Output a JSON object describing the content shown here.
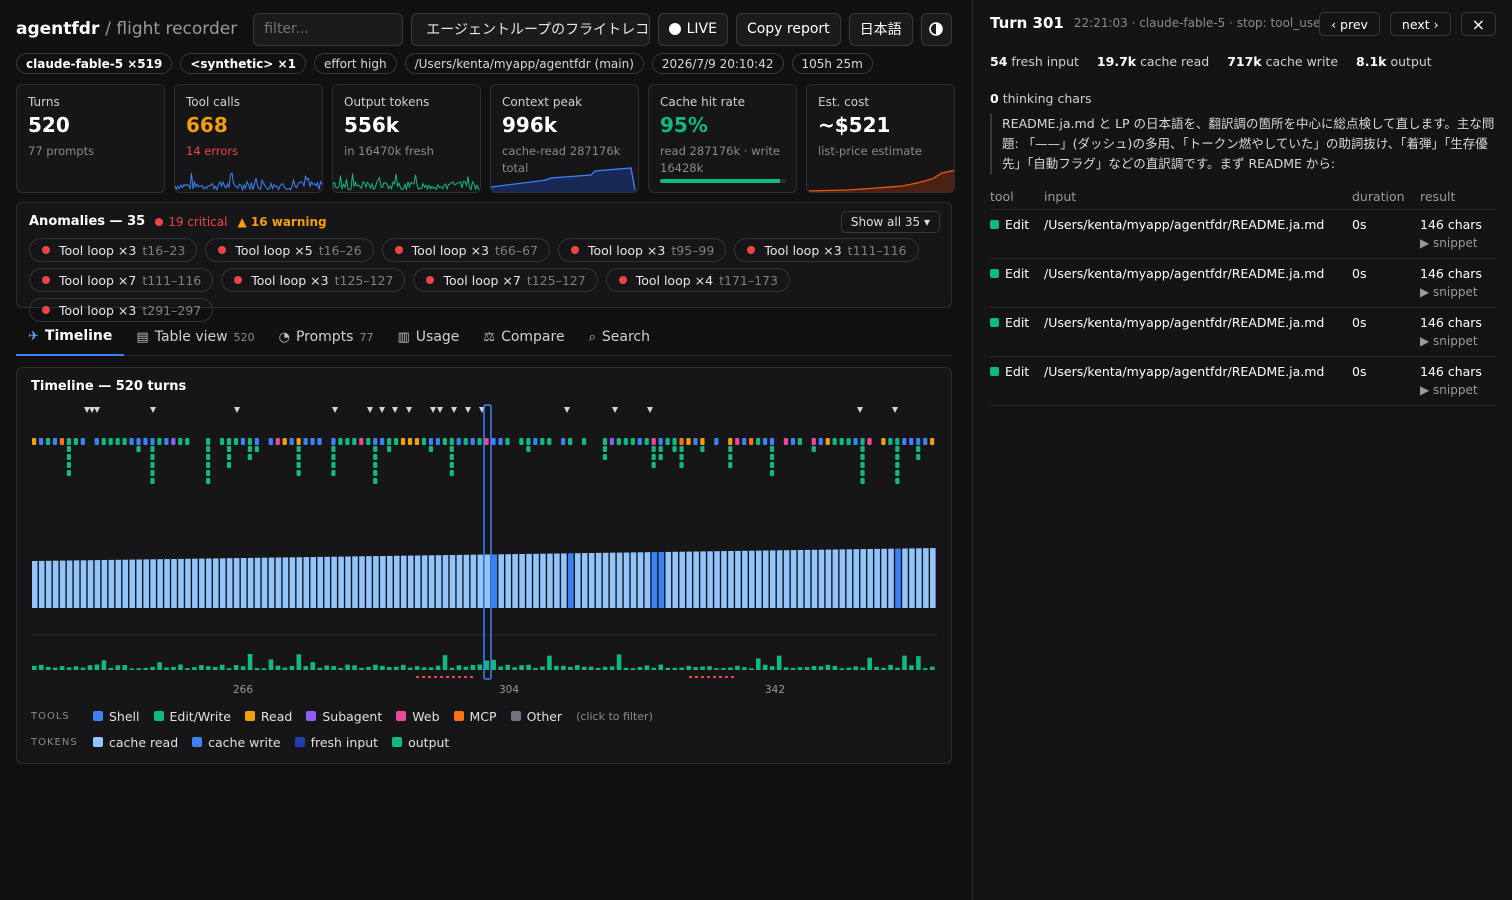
{
  "app": {
    "name": "agentfdr",
    "subtitle": "/ flight recorder"
  },
  "toolbar": {
    "filter_placeholder": "filter...",
    "session_select": "エージェントループのフライトレコーダー",
    "live_label": "LIVE",
    "copy_label": "Copy report",
    "lang_label": "日本語",
    "theme_icon": "half-circle-icon"
  },
  "chips": [
    {
      "strong": "claude-fable-5 ×519",
      "text": ""
    },
    {
      "strong": "<synthetic> ×1",
      "text": ""
    },
    {
      "strong": "",
      "text": "effort high"
    },
    {
      "strong": "",
      "text": "/Users/kenta/myapp/agentfdr (main)"
    },
    {
      "strong": "",
      "text": "2026/7/9 20:10:42"
    },
    {
      "strong": "",
      "text": "105h 25m"
    }
  ],
  "stats": {
    "turns": {
      "label": "Turns",
      "value": "520",
      "sub": "77 prompts"
    },
    "tools": {
      "label": "Tool calls",
      "value": "668",
      "sub": "14 errors"
    },
    "output": {
      "label": "Output tokens",
      "value": "556k",
      "sub": "in 16470k fresh"
    },
    "context": {
      "label": "Context peak",
      "value": "996k",
      "sub": "cache-read 287176k total"
    },
    "cache": {
      "label": "Cache hit rate",
      "value": "95%",
      "sub": "read 287176k · write 16428k",
      "progress": 0.95
    },
    "cost": {
      "label": "Est. cost",
      "value": "~$521",
      "sub": "list-price estimate"
    }
  },
  "anomalies": {
    "title": "Anomalies — 35",
    "critical": "19 critical",
    "warning": "▲ 16 warning",
    "show_all": "Show all 35 ▾",
    "items": [
      {
        "label": "Tool loop ×3",
        "range": "t16–23"
      },
      {
        "label": "Tool loop ×5",
        "range": "t16–26"
      },
      {
        "label": "Tool loop ×3",
        "range": "t66–67"
      },
      {
        "label": "Tool loop ×3",
        "range": "t95–99"
      },
      {
        "label": "Tool loop ×3",
        "range": "t111–116"
      },
      {
        "label": "Tool loop ×7",
        "range": "t111–116"
      },
      {
        "label": "Tool loop ×3",
        "range": "t125–127"
      },
      {
        "label": "Tool loop ×7",
        "range": "t125–127"
      },
      {
        "label": "Tool loop ×4",
        "range": "t171–173"
      },
      {
        "label": "Tool loop ×3",
        "range": "t291–297"
      }
    ]
  },
  "tabs": [
    {
      "label": "Timeline",
      "count": "",
      "icon": "✈"
    },
    {
      "label": "Table view",
      "count": "520",
      "icon": "▤"
    },
    {
      "label": "Prompts",
      "count": "77",
      "icon": "◔"
    },
    {
      "label": "Usage",
      "count": "",
      "icon": "▥"
    },
    {
      "label": "Compare",
      "count": "",
      "icon": "⚖"
    },
    {
      "label": "Search",
      "count": "",
      "icon": "⌕"
    }
  ],
  "timeline": {
    "title": "Timeline — 520 turns",
    "axis_labels": [
      "266",
      "304",
      "342"
    ],
    "tools_heading": "TOOLS",
    "tokens_heading": "TOKENS",
    "filter_hint": "(click to filter)",
    "tool_legend": [
      {
        "label": "Shell",
        "color": "#3b82f6"
      },
      {
        "label": "Edit/Write",
        "color": "#10b981"
      },
      {
        "label": "Read",
        "color": "#f59e0b"
      },
      {
        "label": "Subagent",
        "color": "#8b5cf6"
      },
      {
        "label": "Web",
        "color": "#ec4899"
      },
      {
        "label": "MCP",
        "color": "#f97316"
      },
      {
        "label": "Other",
        "color": "#6b7280"
      }
    ],
    "token_legend": [
      {
        "label": "cache read",
        "color": "#93c5fd"
      },
      {
        "label": "cache write",
        "color": "#3b82f6"
      },
      {
        "label": "fresh input",
        "color": "#1e40af"
      },
      {
        "label": "output",
        "color": "#10b981"
      }
    ]
  },
  "detail": {
    "turn": "Turn 301",
    "meta": "22:21:03 · claude-fable-5 · stop: tool_use",
    "prev": "‹ prev",
    "next": "next ›",
    "close_icon": "×",
    "tokens": [
      {
        "num": "54",
        "label": "fresh input"
      },
      {
        "num": "19.7k",
        "label": "cache read"
      },
      {
        "num": "717k",
        "label": "cache write"
      },
      {
        "num": "8.1k",
        "label": "output"
      }
    ],
    "thinking_num": "0",
    "thinking_label": "thinking chars",
    "message": "README.ja.md と LP の日本語を、翻訳調の箇所を中心に総点検して直します。主な問題: 「——」(ダッシュ)の多用、「トークン燃やしていた」の助詞抜け、「着弾」「生存優先」「自動フラグ」などの直訳調です。まず README から:",
    "columns": [
      "tool",
      "input",
      "duration",
      "result"
    ],
    "rows": [
      {
        "tool": "Edit",
        "input": "/Users/kenta/myapp/agentfdr/README.ja.md",
        "duration": "0s",
        "result": "146 chars",
        "snippet": "▶ snippet"
      },
      {
        "tool": "Edit",
        "input": "/Users/kenta/myapp/agentfdr/README.ja.md",
        "duration": "0s",
        "result": "146 chars",
        "snippet": "▶ snippet"
      },
      {
        "tool": "Edit",
        "input": "/Users/kenta/myapp/agentfdr/README.ja.md",
        "duration": "0s",
        "result": "146 chars",
        "snippet": "▶ snippet"
      },
      {
        "tool": "Edit",
        "input": "/Users/kenta/myapp/agentfdr/README.ja.md",
        "duration": "0s",
        "result": "146 chars",
        "snippet": "▶ snippet"
      }
    ]
  }
}
